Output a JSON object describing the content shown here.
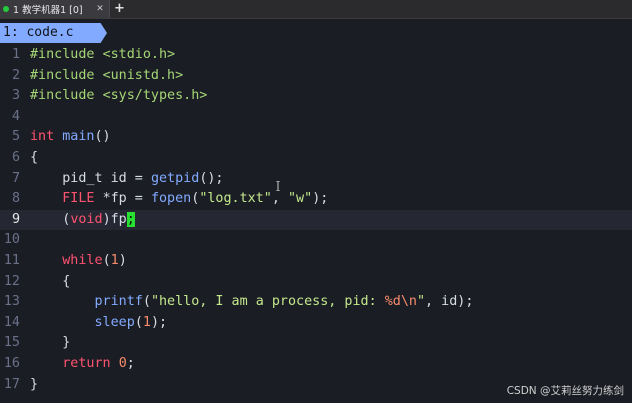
{
  "terminal": {
    "tab_title": "1 教学机器1 [0]",
    "close_glyph": "✕",
    "add_tab_glyph": "+"
  },
  "vim": {
    "buffer_tab": "1: code.c"
  },
  "code": {
    "lines": [
      {
        "n": "1",
        "tokens": [
          {
            "t": "#include ",
            "c": "pre"
          },
          {
            "t": "<stdio.h>",
            "c": "pre"
          }
        ]
      },
      {
        "n": "2",
        "tokens": [
          {
            "t": "#include ",
            "c": "pre"
          },
          {
            "t": "<unistd.h>",
            "c": "pre"
          }
        ]
      },
      {
        "n": "3",
        "tokens": [
          {
            "t": "#include ",
            "c": "pre"
          },
          {
            "t": "<sys/types.h>",
            "c": "pre"
          }
        ]
      },
      {
        "n": "4",
        "tokens": []
      },
      {
        "n": "5",
        "tokens": [
          {
            "t": "int ",
            "c": "kw"
          },
          {
            "t": "main",
            "c": "fn"
          },
          {
            "t": "()",
            "c": "plain"
          }
        ]
      },
      {
        "n": "6",
        "tokens": [
          {
            "t": "{",
            "c": "plain"
          }
        ]
      },
      {
        "n": "7",
        "tokens": [
          {
            "t": "    pid_t id = ",
            "c": "plain"
          },
          {
            "t": "getpid",
            "c": "fn"
          },
          {
            "t": "();",
            "c": "plain"
          }
        ]
      },
      {
        "n": "8",
        "tokens": [
          {
            "t": "    ",
            "c": "plain"
          },
          {
            "t": "FILE ",
            "c": "kw"
          },
          {
            "t": "*fp = ",
            "c": "plain"
          },
          {
            "t": "fopen",
            "c": "fn"
          },
          {
            "t": "(",
            "c": "plain"
          },
          {
            "t": "\"log.txt\"",
            "c": "str"
          },
          {
            "t": ", ",
            "c": "plain"
          },
          {
            "t": "\"w\"",
            "c": "str"
          },
          {
            "t": ");",
            "c": "plain"
          }
        ]
      },
      {
        "n": "9",
        "current": true,
        "tokens": [
          {
            "t": "    (",
            "c": "plain"
          },
          {
            "t": "void",
            "c": "kw"
          },
          {
            "t": ")fp",
            "c": "plain"
          },
          {
            "t": ";",
            "c": "cursor"
          }
        ]
      },
      {
        "n": "10",
        "tokens": []
      },
      {
        "n": "11",
        "tokens": [
          {
            "t": "    ",
            "c": "plain"
          },
          {
            "t": "while",
            "c": "kw"
          },
          {
            "t": "(",
            "c": "plain"
          },
          {
            "t": "1",
            "c": "num"
          },
          {
            "t": ")",
            "c": "plain"
          }
        ]
      },
      {
        "n": "12",
        "tokens": [
          {
            "t": "    {",
            "c": "plain"
          }
        ]
      },
      {
        "n": "13",
        "tokens": [
          {
            "t": "        ",
            "c": "plain"
          },
          {
            "t": "printf",
            "c": "fn"
          },
          {
            "t": "(",
            "c": "plain"
          },
          {
            "t": "\"hello, I am a process, pid: ",
            "c": "str"
          },
          {
            "t": "%d\\n",
            "c": "esc"
          },
          {
            "t": "\"",
            "c": "str"
          },
          {
            "t": ", id);",
            "c": "plain"
          }
        ]
      },
      {
        "n": "14",
        "tokens": [
          {
            "t": "        ",
            "c": "plain"
          },
          {
            "t": "sleep",
            "c": "fn"
          },
          {
            "t": "(",
            "c": "plain"
          },
          {
            "t": "1",
            "c": "num"
          },
          {
            "t": ");",
            "c": "plain"
          }
        ]
      },
      {
        "n": "15",
        "tokens": [
          {
            "t": "    }",
            "c": "plain"
          }
        ]
      },
      {
        "n": "16",
        "tokens": [
          {
            "t": "    ",
            "c": "plain"
          },
          {
            "t": "return ",
            "c": "kw"
          },
          {
            "t": "0",
            "c": "num"
          },
          {
            "t": ";",
            "c": "plain"
          }
        ]
      },
      {
        "n": "17",
        "tokens": [
          {
            "t": "}",
            "c": "plain"
          }
        ]
      }
    ]
  },
  "watermark": "CSDN @艾莉丝努力练剑",
  "colors": {
    "background": "#1b1d24",
    "buffer_tab": "#82aaff",
    "keyword": "#ff5370",
    "function": "#82aaff",
    "string": "#c3e88d",
    "preprocessor": "#a5d676",
    "number": "#f78c6c",
    "cursor": "#27e030"
  }
}
